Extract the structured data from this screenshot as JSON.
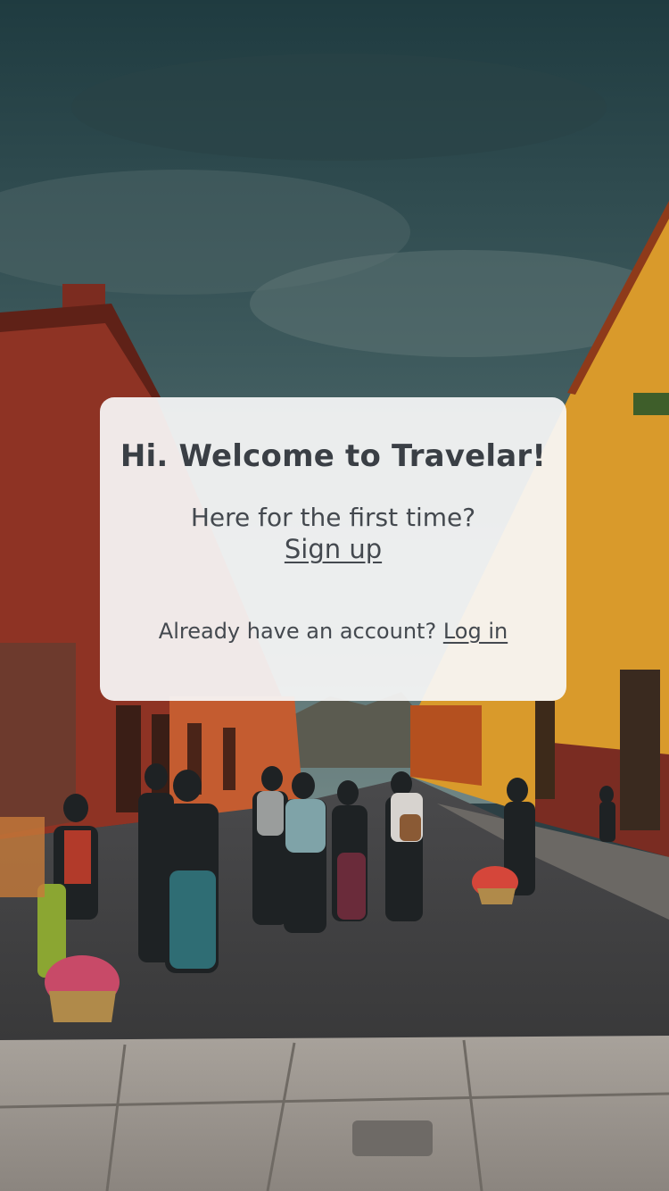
{
  "app": {
    "name": "Travelar"
  },
  "welcome_card": {
    "title": "Hi. Welcome to Travelar!",
    "first_time_prompt": "Here for the first time?",
    "signup_label": "Sign up",
    "account_prompt": "Already have an account?",
    "login_label": "Log in"
  },
  "colors": {
    "card_background": "#f8f8f8",
    "text": "#3a3f45",
    "sky": "#2c4a50",
    "left_building": "#8e3324",
    "right_building": "#d99a2b"
  }
}
